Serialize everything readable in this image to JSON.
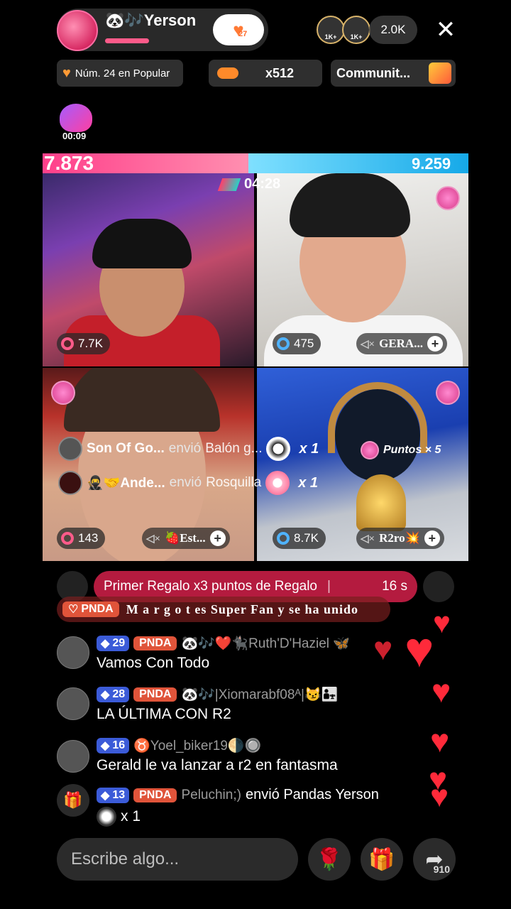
{
  "header": {
    "host_name": "🐼🎶Yerson",
    "likes_count": "27",
    "top_viewer_1": "1K+",
    "top_viewer_2": "1K+",
    "viewer_count": "2.0K",
    "close_glyph": "✕"
  },
  "chips": {
    "ranking": "Núm. 24 en Popular",
    "multiplier": "x512",
    "community": "Communit..."
  },
  "timer_badge": "00:09",
  "battle": {
    "left_score": "7.873",
    "right_score": "9.259",
    "countdown": "04:28",
    "tiles": [
      {
        "stat": "7.7K",
        "name": ""
      },
      {
        "stat": "475",
        "name": "GERA..."
      },
      {
        "stat": "143",
        "name": "🍓Est..."
      },
      {
        "stat": "8.7K",
        "name": "R2ro💥"
      }
    ]
  },
  "gift_feed": [
    {
      "user": "Son Of Go...",
      "verb": "envió",
      "gift": "Balón g...",
      "mult": "x 1"
    },
    {
      "user": "🥷🤝Ande...",
      "verb": "envió",
      "gift": "Rosquilla",
      "mult": "x 1"
    }
  ],
  "puntos": "Puntos × 5",
  "banners": {
    "first_gift": "Primer Regalo x3 puntos de Regalo",
    "first_gift_time": "16 s",
    "pnda_label": "PNDA",
    "super_fan": "M a r g o t es Super Fan y se ha unido"
  },
  "chat": [
    {
      "level": "29",
      "badge": "PNDA",
      "user": "🐼🎶❤️🐈‍⬛Ruth'D'Haziel 🦋",
      "message": "Vamos Con Todo"
    },
    {
      "level": "28",
      "badge": "PNDA",
      "user": "🐼🎶|Xiomarabf08ᴬ|😼👨‍👧",
      "message": "LA ÚLTIMA CON R2"
    },
    {
      "level": "16",
      "badge": "",
      "user": "♉Yoel_biker19🌗🔘",
      "message": "Gerald le va lanzar a r2 en fantasma"
    },
    {
      "level": "13",
      "badge": "PNDA",
      "user": "Peluchin;)",
      "message": "envió Pandas Yerson",
      "mult": "x 1"
    }
  ],
  "composer": {
    "placeholder": "Escribe algo...",
    "share_count": "910"
  },
  "colors": {
    "left_team": "#ff3f8a",
    "right_team": "#16a9e8",
    "banner": "#c81e46",
    "heart": "#ff2a3a"
  },
  "icons": [
    "heart-icon",
    "close-icon",
    "rose-icon",
    "gift-icon",
    "share-icon",
    "mute-icon",
    "plus-icon"
  ]
}
